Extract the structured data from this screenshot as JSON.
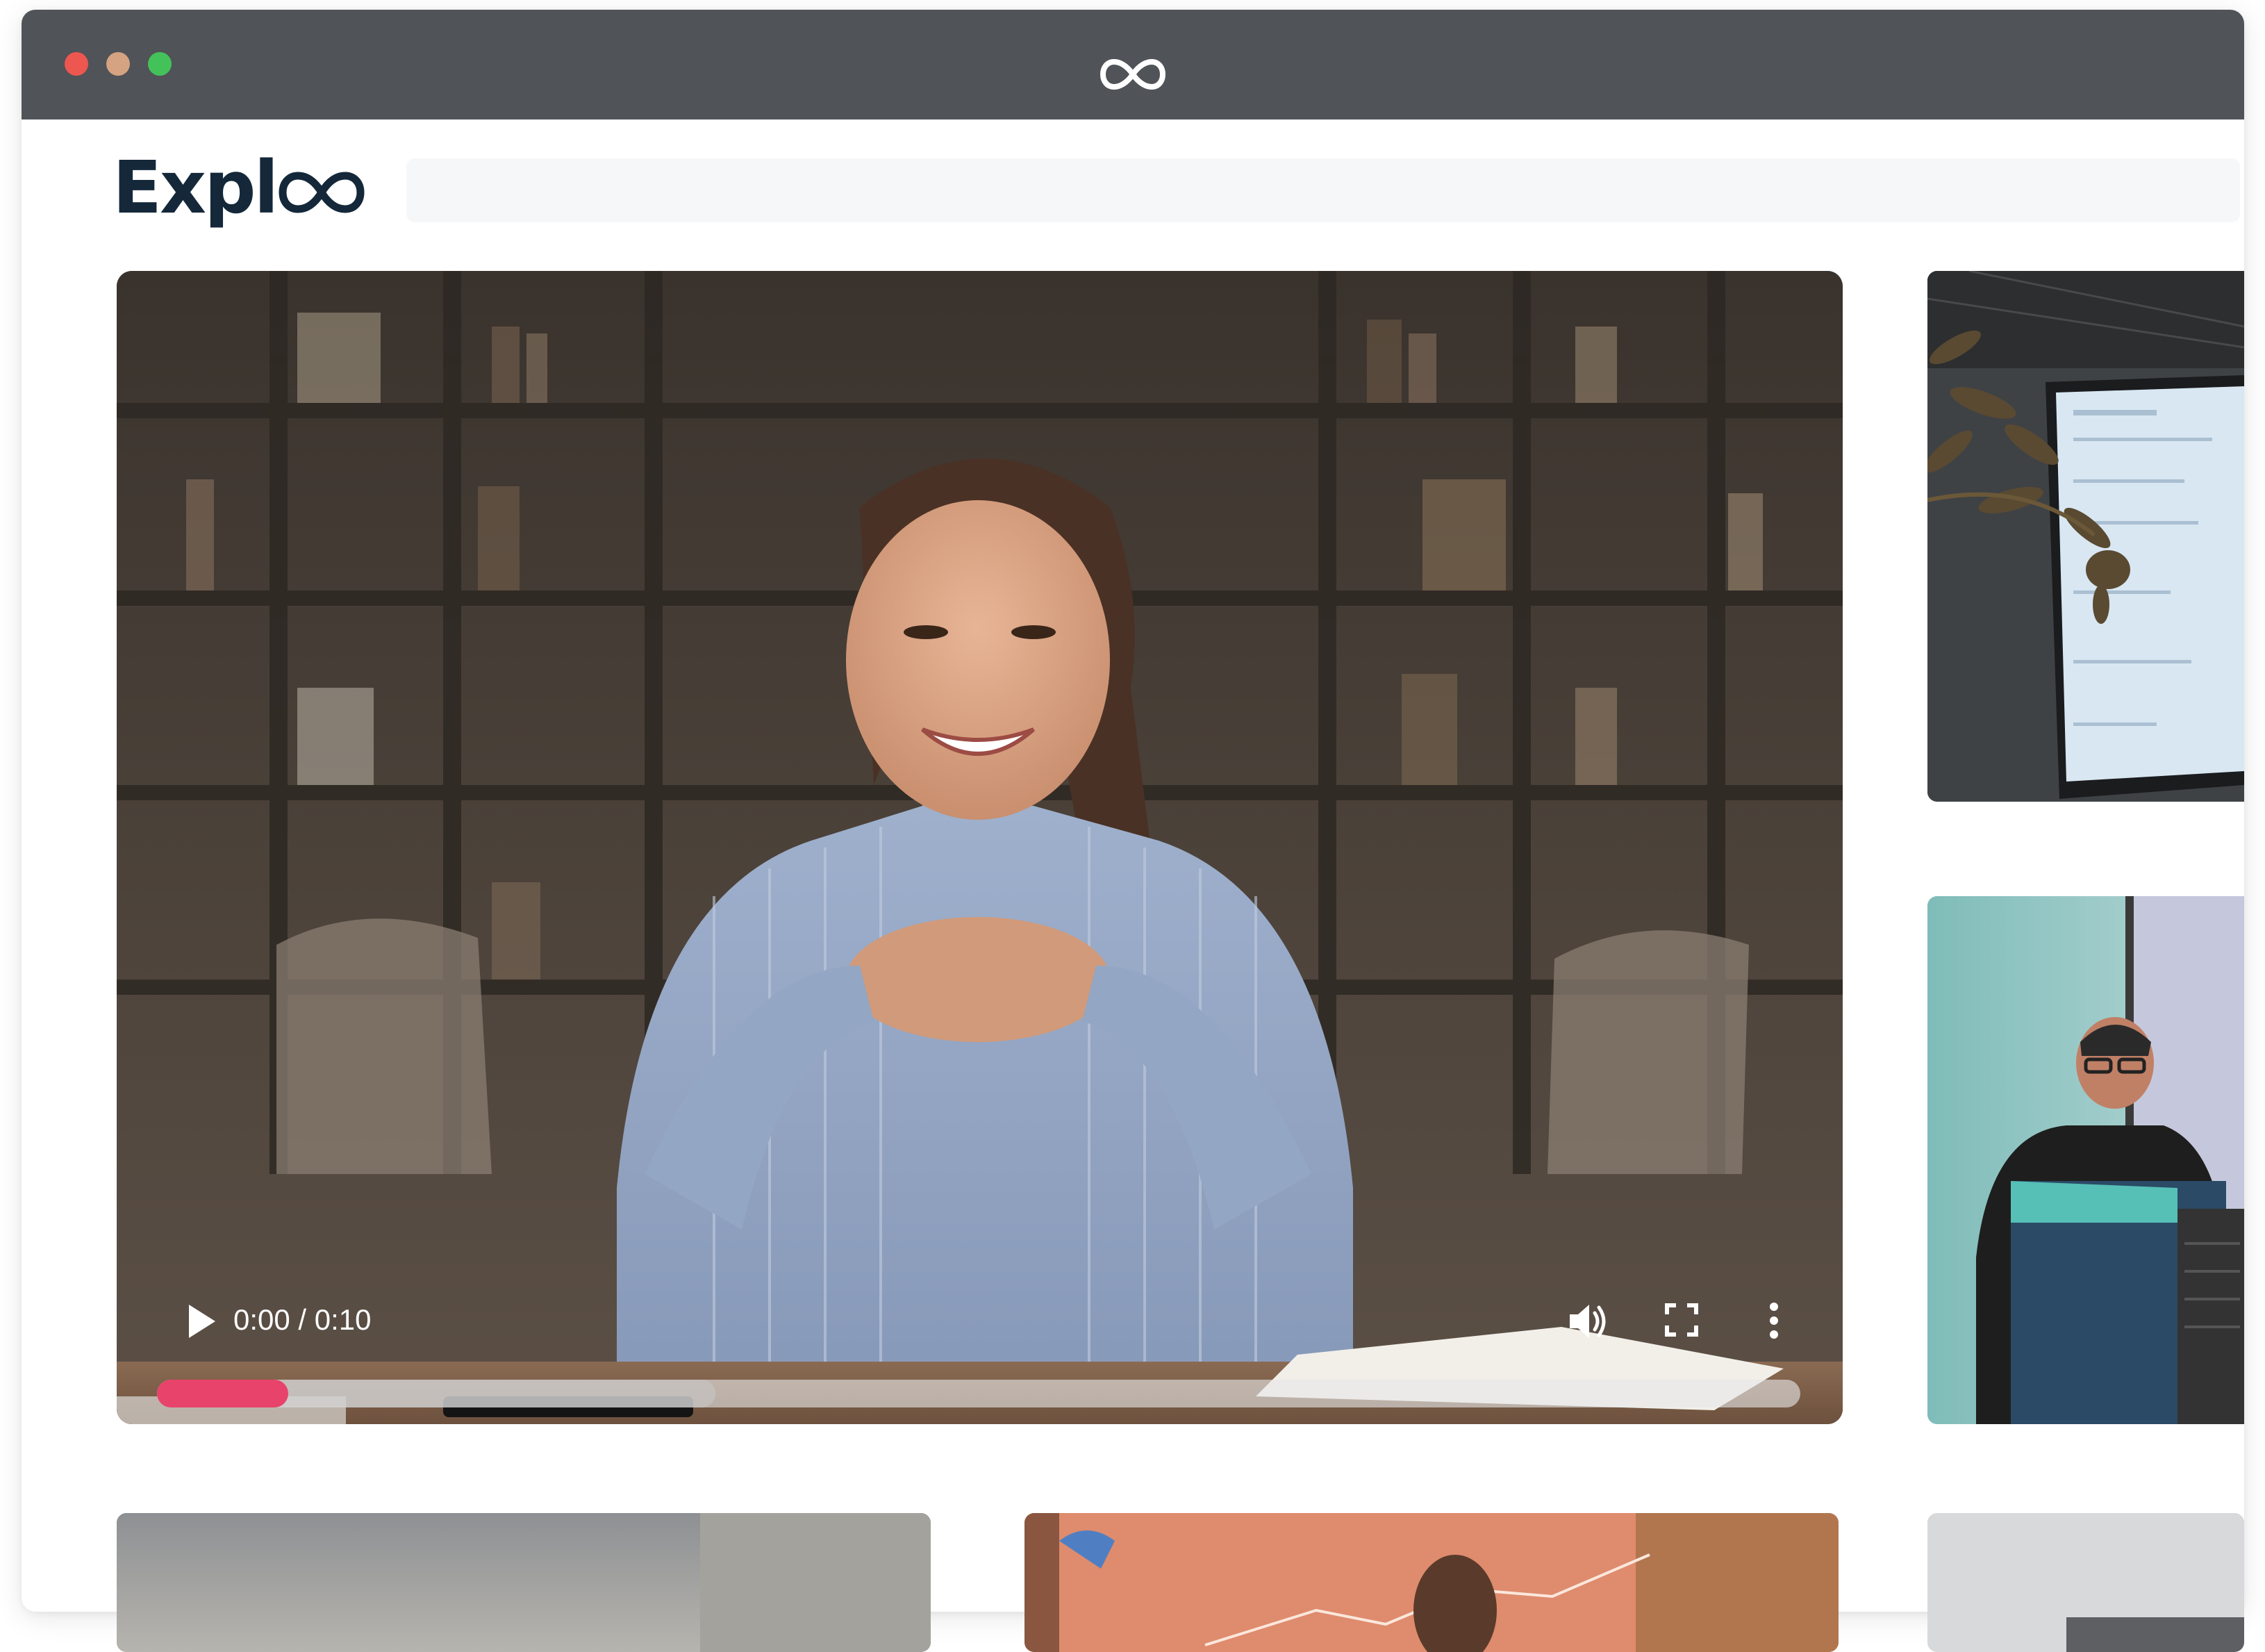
{
  "window": {
    "titlebar_icon": "infinity-logo-icon"
  },
  "header": {
    "brand_text": "Expl",
    "brand_mark_icon": "infinity-mark-icon",
    "brand_color": "#14283a"
  },
  "player": {
    "time_display": "0:00 / 0:10",
    "progress_fraction": 0.08,
    "accent_color": "#e8436a",
    "controls": {
      "play_icon": "play-icon",
      "volume_icon": "volume-icon",
      "fullscreen_icon": "fullscreen-icon",
      "more_icon": "more-vertical-icon"
    }
  }
}
